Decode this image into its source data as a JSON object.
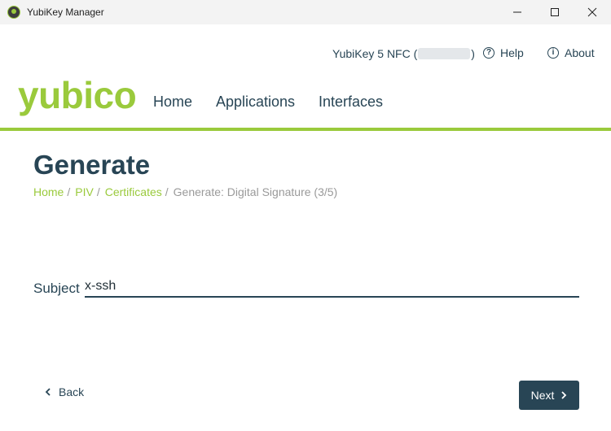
{
  "window": {
    "title": "YubiKey Manager",
    "icons": {
      "minimize": "minimize-icon",
      "maximize": "maximize-icon",
      "close": "close-icon"
    }
  },
  "header": {
    "device_label": "YubiKey 5 NFC (",
    "device_label_end": ")",
    "help_label": "Help",
    "about_label": "About"
  },
  "nav": {
    "logo": "yubico",
    "items": [
      "Home",
      "Applications",
      "Interfaces"
    ]
  },
  "page": {
    "title": "Generate",
    "breadcrumb": {
      "items": [
        "Home",
        "PIV",
        "Certificates"
      ],
      "separator": "/",
      "current": "Generate: Digital Signature (3/5)"
    },
    "subject": {
      "label": "Subject",
      "value": "x-ssh"
    },
    "back_label": "Back",
    "next_label": "Next"
  },
  "colors": {
    "brand_green": "#9aca3c",
    "navy": "#284555"
  }
}
